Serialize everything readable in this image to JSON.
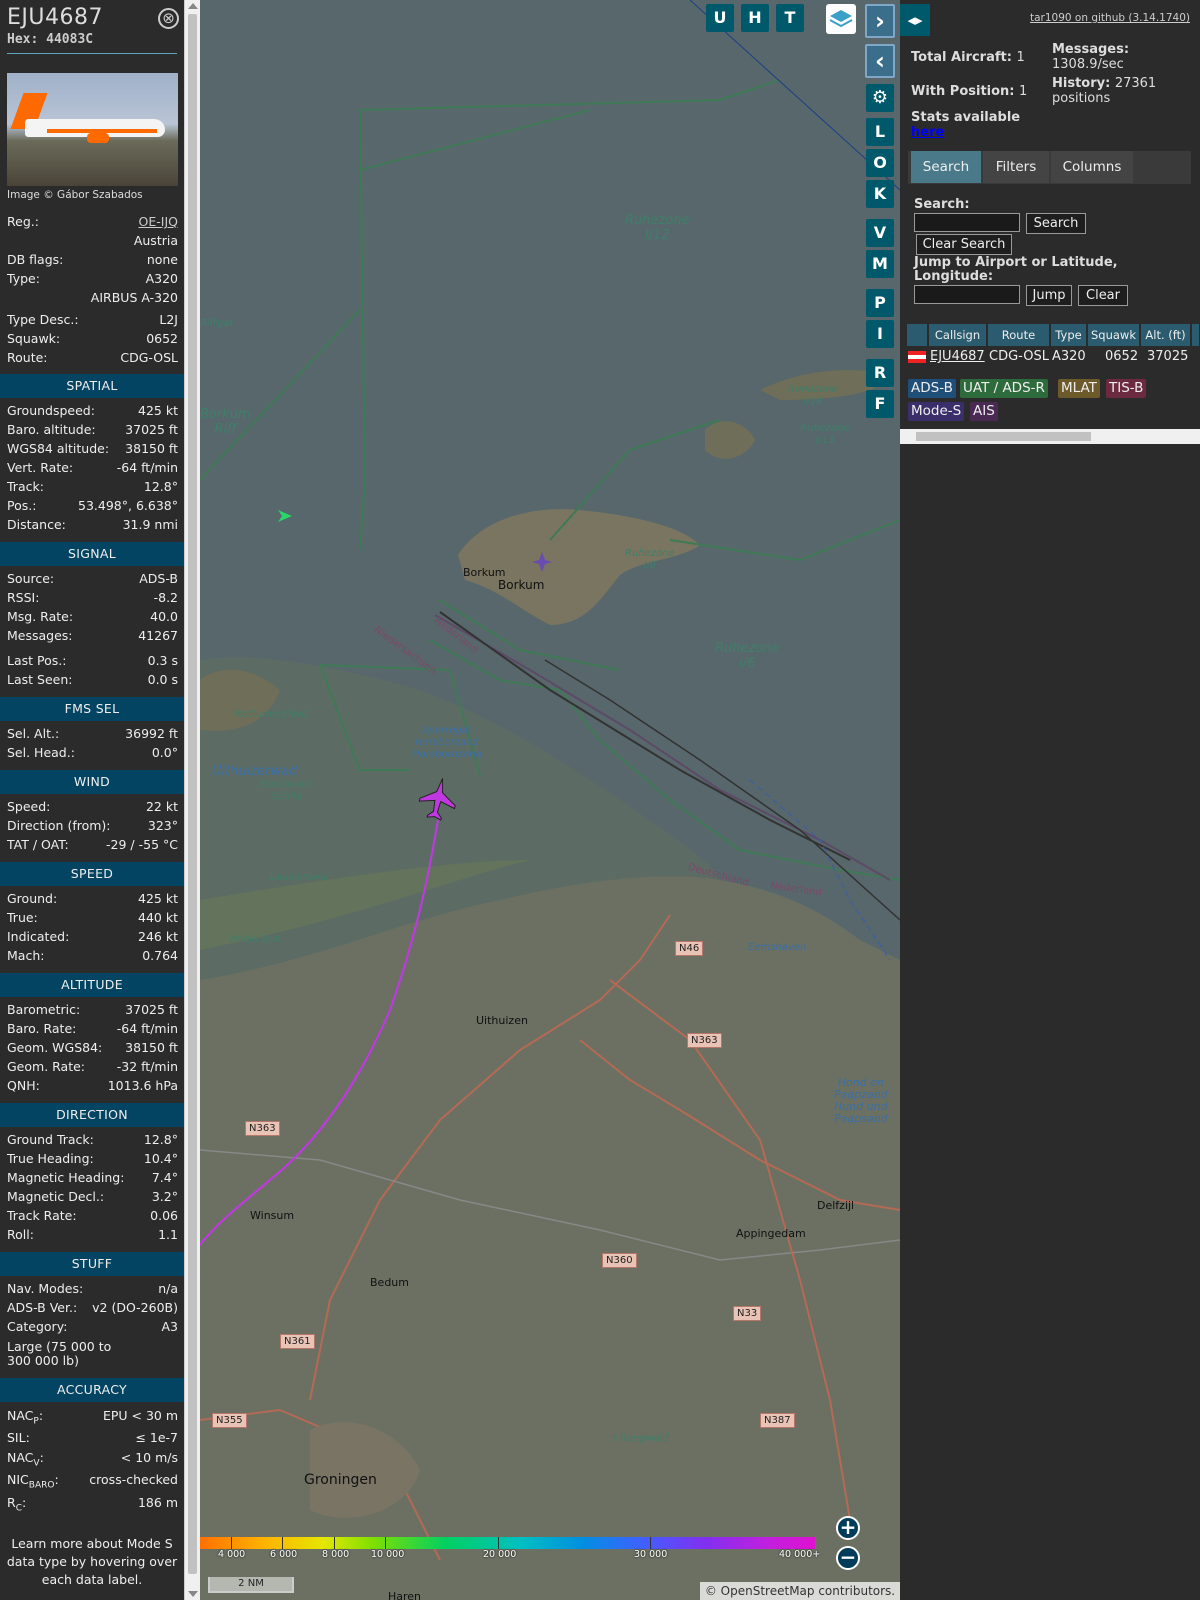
{
  "aircraft": {
    "callsign": "EJU4687",
    "hex": "Hex: 44083C",
    "photo_credit": "Image © Gábor Szabados",
    "close_glyph": "⊗"
  },
  "info": {
    "reg_label": "Reg.:",
    "reg": "OE-IJQ",
    "country": "Austria",
    "dbflags_label": "DB flags:",
    "dbflags": "none",
    "type_label": "Type:",
    "type": "A320",
    "type_full": "AIRBUS A-320",
    "typedesc_label": "Type Desc.:",
    "typedesc": "L2J",
    "squawk_label": "Squawk:",
    "squawk": "0652",
    "route_label": "Route:",
    "route": "CDG-OSL"
  },
  "spatial": {
    "title": "SPATIAL",
    "rows": [
      {
        "k": "Groundspeed:",
        "v": "425 kt"
      },
      {
        "k": "Baro. altitude:",
        "v": "37025 ft"
      },
      {
        "k": "WGS84 altitude:",
        "v": "38150 ft"
      },
      {
        "k": "Vert. Rate:",
        "v": "-64 ft/min"
      },
      {
        "k": "Track:",
        "v": "12.8°"
      },
      {
        "k": "Pos.:",
        "v": "53.498°, 6.638°"
      },
      {
        "k": "Distance:",
        "v": "31.9 nmi"
      }
    ]
  },
  "signal": {
    "title": "SIGNAL",
    "rows": [
      {
        "k": "Source:",
        "v": "ADS-B"
      },
      {
        "k": "RSSI:",
        "v": "-8.2"
      },
      {
        "k": "Msg. Rate:",
        "v": "40.0"
      },
      {
        "k": "Messages:",
        "v": "41267"
      },
      {
        "k": "Last Pos.:",
        "v": "0.3 s"
      },
      {
        "k": "Last Seen:",
        "v": "0.0 s"
      }
    ]
  },
  "fms": {
    "title": "FMS SEL",
    "rows": [
      {
        "k": "Sel. Alt.:",
        "v": "36992 ft"
      },
      {
        "k": "Sel. Head.:",
        "v": "0.0°"
      }
    ]
  },
  "wind": {
    "title": "WIND",
    "rows": [
      {
        "k": "Speed:",
        "v": "22 kt"
      },
      {
        "k": "Direction (from):",
        "v": "323°"
      },
      {
        "k": "TAT / OAT:",
        "v": "-29 / -55 °C"
      }
    ]
  },
  "speed": {
    "title": "SPEED",
    "rows": [
      {
        "k": "Ground:",
        "v": "425 kt"
      },
      {
        "k": "True:",
        "v": "440 kt"
      },
      {
        "k": "Indicated:",
        "v": "246 kt"
      },
      {
        "k": "Mach:",
        "v": "0.764"
      }
    ]
  },
  "altitude": {
    "title": "ALTITUDE",
    "rows": [
      {
        "k": "Barometric:",
        "v": "37025 ft"
      },
      {
        "k": "Baro. Rate:",
        "v": "-64 ft/min"
      },
      {
        "k": "Geom. WGS84:",
        "v": "38150 ft"
      },
      {
        "k": "Geom. Rate:",
        "v": "-32 ft/min"
      },
      {
        "k": "QNH:",
        "v": "1013.6 hPa"
      }
    ]
  },
  "direction": {
    "title": "DIRECTION",
    "rows": [
      {
        "k": "Ground Track:",
        "v": "12.8°"
      },
      {
        "k": "True Heading:",
        "v": "10.4°"
      },
      {
        "k": "Magnetic Heading:",
        "v": "7.4°"
      },
      {
        "k": "Magnetic Decl.:",
        "v": "3.2°"
      },
      {
        "k": "Track Rate:",
        "v": "0.06"
      },
      {
        "k": "Roll:",
        "v": "1.1"
      }
    ]
  },
  "stuff": {
    "title": "STUFF",
    "rows": [
      {
        "k": "Nav. Modes:",
        "v": "n/a"
      },
      {
        "k": "ADS-B Ver.:",
        "v": "v2 (DO-260B)"
      },
      {
        "k": "Category:",
        "v": "A3"
      }
    ],
    "large_note": "Large (75 000 to 300 000 lb)"
  },
  "accuracy": {
    "title": "ACCURACY",
    "nacp_k": "NAC",
    "nacp_sub": "P",
    "nacp_v": "EPU < 30 m",
    "sil_k": "SIL:",
    "sil_v": "≤ 1e-7",
    "nacv_k": "NAC",
    "nacv_sub": "V",
    "nacv_v": "< 10 m/s",
    "nicbaro_k": "NIC",
    "nicbaro_sub": "BARO",
    "nicbaro_v": "cross-checked",
    "rc_k": "R",
    "rc_sub": "C",
    "rc_v": "186 m",
    "colon": ":"
  },
  "learn_more": "Learn more about Mode S data type by hovering over each data label.",
  "map": {
    "buttons_top": [
      "U",
      "H",
      "T"
    ],
    "side_buttons": [
      "L",
      "O",
      "K",
      "V",
      "M",
      "P",
      "I",
      "R",
      "F"
    ],
    "next_glyph": "›",
    "prev_glyph": "‹",
    "gear_glyph": "⚙",
    "zoom_in": "+",
    "zoom_out": "−",
    "scale": "2 NM",
    "attribution": "© OpenStreetMap contributors.",
    "alt_ticks": [
      "4 000",
      "6 000",
      "8 000",
      "10 000",
      "20 000",
      "30 000",
      "40 000+"
    ],
    "labels": {
      "ruhezone_i12": "Ruhezone\nI/12",
      "riffgat": "Riffgat",
      "borkum_riff": "Borkum\nRiff",
      "ruhezone_i14": "Ruhezone\nI/14",
      "ruhezone_i13": "Ruhezone\nI/13",
      "ruhezone_i8": "Ruhezone\nI/8",
      "ruhezone_i6": "Ruhezone\nI/6",
      "borkum_town": "Borkum",
      "borkum_island": "Borkum",
      "nedersaksen": "Niedersachsen",
      "nederland1": "Nederland",
      "rottumerplaat": "Rottumerplaat",
      "sparregat": "Sparregat\nHorsborzand\nHorsbornzand",
      "uithuizerwad": "Uithuizerwad",
      "boschwad": "Boschwad-\nSchild",
      "lauwerswal": "Lauwerswal",
      "andelbult": "Andel Bult",
      "deutschland": "Deutschland",
      "nederland2": "Nederland",
      "eemshaven": "Eemshaven",
      "uithuizen": "Uithuizen",
      "hondpaap": "Hond en\nPaapzand\nHund und\nPaapsand",
      "winsum": "Winsum",
      "delfzijl": "Delfzijl",
      "appingedam": "Appingedam",
      "bedum": "Bedum",
      "roegwold": "'t Roegwold",
      "groningen": "Groningen",
      "haren": "Haren"
    },
    "roads": {
      "n46": "N46",
      "n363a": "N363",
      "n363b": "N363",
      "n360": "N360",
      "n33": "N33",
      "n361": "N361",
      "n355": "N355",
      "n387": "N387"
    }
  },
  "right": {
    "expand_glyph": "◂▸",
    "github": "tar1090 on github (3.14.1740)",
    "total_label": "Total Aircraft:",
    "total": "1",
    "withpos_label": "With Position:",
    "withpos": "1",
    "stats_label": "Stats available",
    "stats_link": "here",
    "messages_label": "Messages:",
    "messages": "1308.9/sec",
    "history_label": "History:",
    "history": "27361 positions",
    "tabs": [
      "Search",
      "Filters",
      "Columns"
    ],
    "search_label": "Search:",
    "search_btn": "Search",
    "clear_search_btn": "Clear Search",
    "jump_label": "Jump to Airport or Latitude, Longitude:",
    "jump_btn": "Jump",
    "clear_btn": "Clear",
    "table_headers": [
      "Callsign",
      "Route",
      "Type",
      "Squawk",
      "Alt. (ft)"
    ],
    "table_row": {
      "callsign": "EJU4687",
      "route": "CDG-OSL",
      "type": "A320",
      "squawk": "0652",
      "alt": "37025"
    },
    "chips": [
      "ADS-B",
      "UAT / ADS-R",
      "MLAT",
      "TIS-B",
      "Mode-S",
      "AIS"
    ],
    "colors": {
      "adsb": "#1f4e79",
      "uat": "#2e6b3c",
      "mlat": "#6d5a2a",
      "tisb": "#6b2a40",
      "modes": "#3b2f6b",
      "ais": "#4a2a52"
    }
  }
}
